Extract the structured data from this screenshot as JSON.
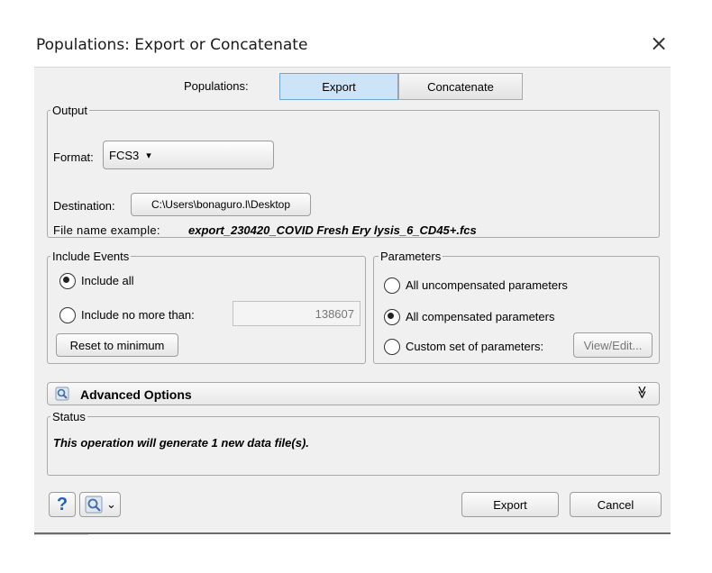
{
  "window": {
    "title": "Populations: Export or Concatenate",
    "close_glyph": "×"
  },
  "mode": {
    "label": "Populations:",
    "export_tab": "Export",
    "concatenate_tab": "Concatenate",
    "selected": "Export"
  },
  "output": {
    "legend": "Output",
    "format_label": "Format:",
    "format_value": "FCS3",
    "format_arrow": "▾",
    "destination_label": "Destination:",
    "destination_value": "C:\\Users\\bonaguro.l\\Desktop",
    "file_name_label": "File name example:",
    "file_name_value": "export_230420_COVID Fresh Ery lysis_6_CD45+.fcs"
  },
  "include_events": {
    "legend": "Include Events",
    "include_all": "Include all",
    "include_no_more_than": "Include no more than:",
    "max_value": "138607",
    "reset_button": "Reset to minimum",
    "selected": "include_all"
  },
  "parameters": {
    "legend": "Parameters",
    "uncompensated": "All uncompensated parameters",
    "compensated": "All compensated parameters",
    "custom": "Custom set of parameters:",
    "view_edit": "View/Edit...",
    "selected": "compensated"
  },
  "advanced": {
    "label": "Advanced Options",
    "icon": "magnifier-icon",
    "expand_glyph": "≫"
  },
  "status": {
    "legend": "Status",
    "message": "This operation will generate 1 new data file(s)."
  },
  "footer": {
    "help_glyph": "?",
    "export_button": "Export",
    "cancel_button": "Cancel",
    "dropdown_glyph": "⌄"
  },
  "colors": {
    "dialog_bg": "#f0f0f0",
    "selected_tab": "#cde3f7",
    "help_blue": "#1f5fbf"
  }
}
